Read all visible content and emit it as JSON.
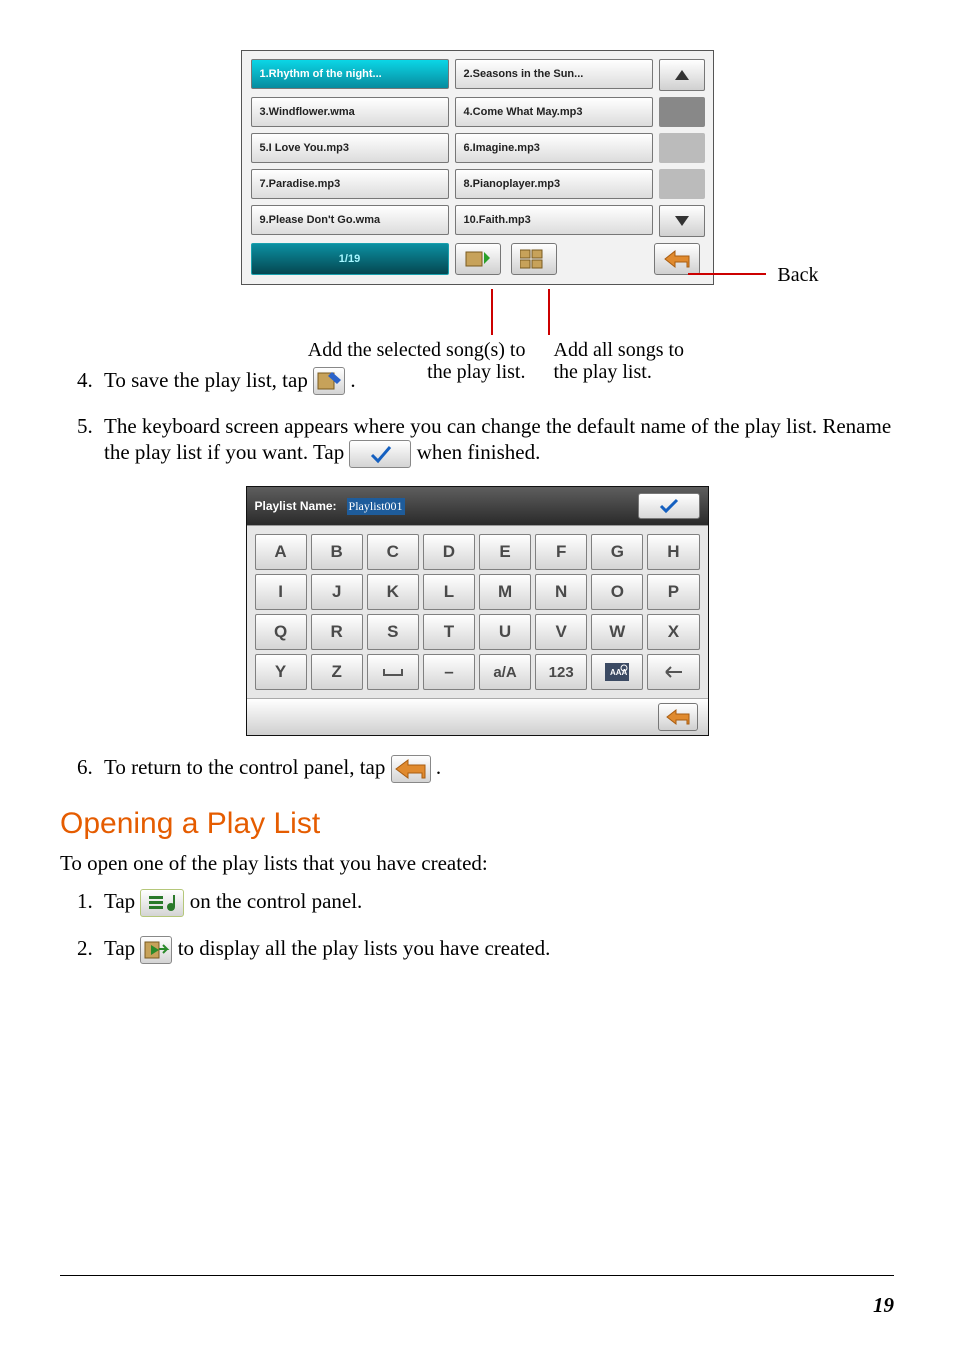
{
  "songpicker": {
    "songs": [
      "1.Rhythm of the night...",
      "2.Seasons in the Sun...",
      "3.Windflower.wma",
      "4.Come What May.mp3",
      "5.I Love You.mp3",
      "6.Imagine.mp3",
      "7.Paradise.mp3",
      "8.Pianoplayer.mp3",
      "9.Please Don't Go.wma",
      "10.Faith.mp3"
    ],
    "counter": "1/19",
    "back_label": "Back",
    "caption_left": "Add the selected song(s) to the play list.",
    "caption_right": "Add all songs to the play list."
  },
  "steps_a": {
    "s4_a": "To save the play list, tap ",
    "s4_b": ".",
    "s5_a": "The keyboard screen appears where you can change the default name of the play list. Rename the play list if you want. Tap ",
    "s5_b": " when finished.",
    "s6_a": "To return to the control panel, tap ",
    "s6_b": "."
  },
  "keyboard": {
    "label": "Playlist Name:",
    "value": "Playlist001",
    "keys": [
      "A",
      "B",
      "C",
      "D",
      "E",
      "F",
      "G",
      "H",
      "I",
      "J",
      "K",
      "L",
      "M",
      "N",
      "O",
      "P",
      "Q",
      "R",
      "S",
      "T",
      "U",
      "V",
      "W",
      "X",
      "Y",
      "Z",
      "␣",
      "–",
      "a/A",
      "123",
      "AAA",
      "←"
    ]
  },
  "section_heading": "Opening a Play List",
  "open_intro": "To open one of the play lists that you have created:",
  "steps_b": {
    "s1_a": "Tap ",
    "s1_b": " on the control panel.",
    "s2_a": "Tap ",
    "s2_b": " to display all the play lists you have created."
  },
  "page_number": "19"
}
